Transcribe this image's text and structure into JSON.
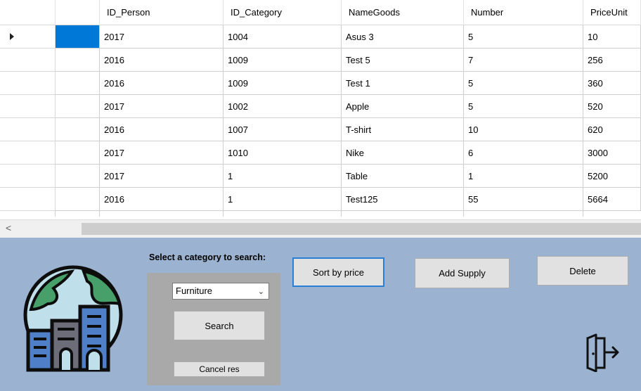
{
  "grid": {
    "columns": [
      "ID_Person",
      "ID_Category",
      "NameGoods",
      "Number",
      "PriceUnit"
    ],
    "rows": [
      [
        "2017",
        "1004",
        "Asus 3",
        "5",
        "10"
      ],
      [
        "2016",
        "1009",
        "Test 5",
        "7",
        "256"
      ],
      [
        "2016",
        "1009",
        "Test 1",
        "5",
        "360"
      ],
      [
        "2017",
        "1002",
        "Apple",
        "5",
        "520"
      ],
      [
        "2016",
        "1007",
        "T-shirt",
        "10",
        "620"
      ],
      [
        "2017",
        "1010",
        "Nike",
        "6",
        "3000"
      ],
      [
        "2017",
        "1",
        "Table",
        "1",
        "5200"
      ],
      [
        "2016",
        "1",
        "Test125",
        "55",
        "5664"
      ]
    ]
  },
  "scrollbar": {
    "left_arrow": "<"
  },
  "panel": {
    "search_label": "Select a category to search:",
    "category_selected": "Furniture",
    "search_button": "Search",
    "cancel_button": "Cancel res",
    "sort_button": "Sort by price",
    "add_button": "Add Supply",
    "delete_button": "Delete"
  },
  "icons": {
    "logo": "city-globe-icon",
    "exit": "exit-door-icon"
  },
  "colors": {
    "panel_bg": "#9bb3d1",
    "selection": "#0078d7",
    "search_box_bg": "#a9a9a9"
  }
}
